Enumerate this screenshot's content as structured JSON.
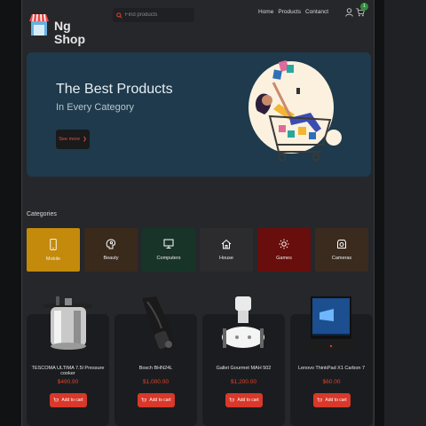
{
  "brand": {
    "line1": "Ng",
    "line2": "Shop"
  },
  "search": {
    "placeholder": "Find products"
  },
  "nav": {
    "items": [
      "Home",
      "Products",
      "Contanct"
    ]
  },
  "cart": {
    "count": "1"
  },
  "hero": {
    "title": "The Best Products",
    "subtitle": "In Every Category",
    "button_label": "See more",
    "button_arrow": "❯"
  },
  "categories": {
    "title": "Categories",
    "items": [
      {
        "label": "Mobile",
        "icon": "phone-icon",
        "color": "#c48a0c"
      },
      {
        "label": "Beauty",
        "icon": "face-icon",
        "color": "#3a2a1c"
      },
      {
        "label": "Computers",
        "icon": "monitor-icon",
        "color": "#183428"
      },
      {
        "label": "House",
        "icon": "house-icon",
        "color": "#2c2c2e"
      },
      {
        "label": "Games",
        "icon": "sun-icon",
        "color": "#680e0c"
      },
      {
        "label": "Cameras",
        "icon": "camera-icon",
        "color": "#3b2b1f"
      }
    ]
  },
  "products": [
    {
      "name": "TESCOMA ULTIMA 7.5l Pressure cooker",
      "price": "$490.90",
      "button": "Add to cart",
      "image": "pressure-cooker"
    },
    {
      "name": "Bosch BHN24L",
      "price": "$1,000.00",
      "button": "Add to cart",
      "image": "handheld-vacuum"
    },
    {
      "name": "Gallet Gourmet MAH 502",
      "price": "$1,200.00",
      "button": "Add to cart",
      "image": "food-processor"
    },
    {
      "name": "Lenovo ThinkPad X1 Carbon 7",
      "price": "$60.00",
      "button": "Add to cart",
      "image": "laptop"
    }
  ],
  "colors": {
    "accent": "#d9382a",
    "price": "#e0452c",
    "hero_bg": "#1e3a4c",
    "badge": "#2f8f3a"
  }
}
